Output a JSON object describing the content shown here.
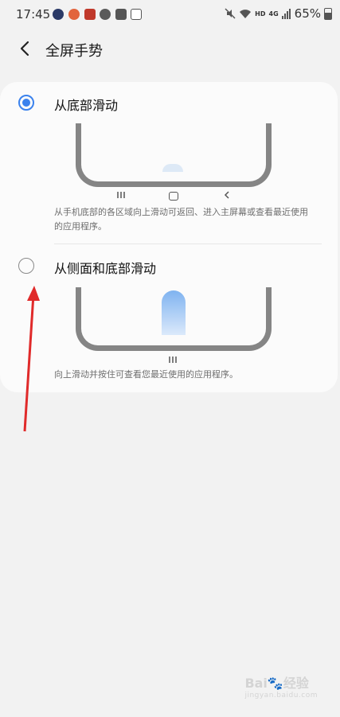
{
  "status_bar": {
    "time": "17:45",
    "network": "HD",
    "signal": "4G",
    "battery": "65%",
    "notification_icons": [
      "ie-icon",
      "app-icon-orange",
      "app-icon-red",
      "s-icon",
      "check-icon",
      "image-icon"
    ]
  },
  "header": {
    "title": "全屏手势"
  },
  "options": [
    {
      "label": "从底部滑动",
      "selected": true,
      "description": "从手机底部的各区域向上滑动可返回、进入主屏幕或查看最近使用的应用程序。",
      "nav_icons": [
        "recents-icon",
        "home-icon",
        "back-icon"
      ]
    },
    {
      "label": "从侧面和底部滑动",
      "selected": false,
      "description": "向上滑动并按住可查看您最近使用的应用程序。",
      "nav_icons": [
        "recents-icon"
      ]
    }
  ],
  "watermark": {
    "text": "Bai",
    "text2": "经验",
    "sub": "jingyan.baidu.com"
  },
  "colors": {
    "accent": "#3b82ed",
    "annotation_arrow": "#e02a2a",
    "card_bg": "#fbfbfb",
    "page_bg": "#f2f2f2"
  }
}
